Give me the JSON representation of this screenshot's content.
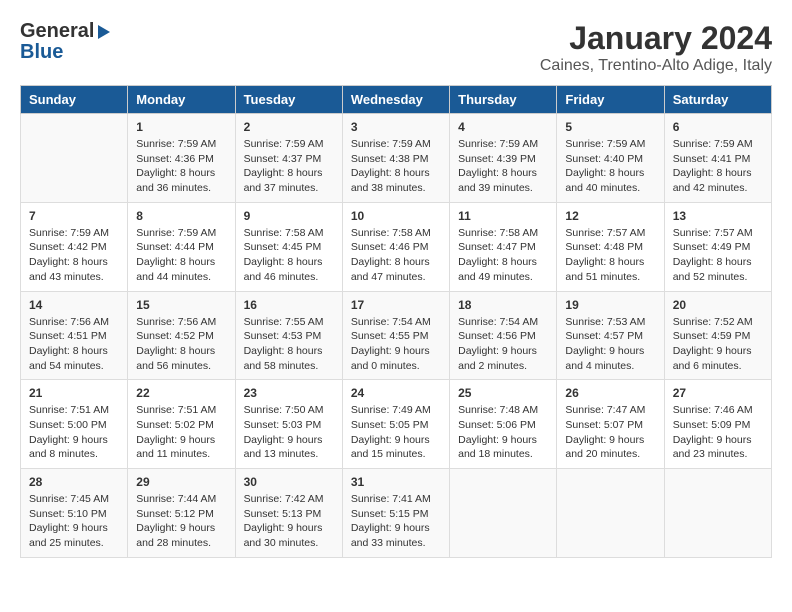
{
  "header": {
    "logo_general": "General",
    "logo_blue": "Blue",
    "month_year": "January 2024",
    "location": "Caines, Trentino-Alto Adige, Italy"
  },
  "days_of_week": [
    "Sunday",
    "Monday",
    "Tuesday",
    "Wednesday",
    "Thursday",
    "Friday",
    "Saturday"
  ],
  "weeks": [
    {
      "days": [
        {
          "num": "",
          "sunrise": "",
          "sunset": "",
          "daylight": ""
        },
        {
          "num": "1",
          "sunrise": "Sunrise: 7:59 AM",
          "sunset": "Sunset: 4:36 PM",
          "daylight": "Daylight: 8 hours and 36 minutes."
        },
        {
          "num": "2",
          "sunrise": "Sunrise: 7:59 AM",
          "sunset": "Sunset: 4:37 PM",
          "daylight": "Daylight: 8 hours and 37 minutes."
        },
        {
          "num": "3",
          "sunrise": "Sunrise: 7:59 AM",
          "sunset": "Sunset: 4:38 PM",
          "daylight": "Daylight: 8 hours and 38 minutes."
        },
        {
          "num": "4",
          "sunrise": "Sunrise: 7:59 AM",
          "sunset": "Sunset: 4:39 PM",
          "daylight": "Daylight: 8 hours and 39 minutes."
        },
        {
          "num": "5",
          "sunrise": "Sunrise: 7:59 AM",
          "sunset": "Sunset: 4:40 PM",
          "daylight": "Daylight: 8 hours and 40 minutes."
        },
        {
          "num": "6",
          "sunrise": "Sunrise: 7:59 AM",
          "sunset": "Sunset: 4:41 PM",
          "daylight": "Daylight: 8 hours and 42 minutes."
        }
      ]
    },
    {
      "days": [
        {
          "num": "7",
          "sunrise": "Sunrise: 7:59 AM",
          "sunset": "Sunset: 4:42 PM",
          "daylight": "Daylight: 8 hours and 43 minutes."
        },
        {
          "num": "8",
          "sunrise": "Sunrise: 7:59 AM",
          "sunset": "Sunset: 4:44 PM",
          "daylight": "Daylight: 8 hours and 44 minutes."
        },
        {
          "num": "9",
          "sunrise": "Sunrise: 7:58 AM",
          "sunset": "Sunset: 4:45 PM",
          "daylight": "Daylight: 8 hours and 46 minutes."
        },
        {
          "num": "10",
          "sunrise": "Sunrise: 7:58 AM",
          "sunset": "Sunset: 4:46 PM",
          "daylight": "Daylight: 8 hours and 47 minutes."
        },
        {
          "num": "11",
          "sunrise": "Sunrise: 7:58 AM",
          "sunset": "Sunset: 4:47 PM",
          "daylight": "Daylight: 8 hours and 49 minutes."
        },
        {
          "num": "12",
          "sunrise": "Sunrise: 7:57 AM",
          "sunset": "Sunset: 4:48 PM",
          "daylight": "Daylight: 8 hours and 51 minutes."
        },
        {
          "num": "13",
          "sunrise": "Sunrise: 7:57 AM",
          "sunset": "Sunset: 4:49 PM",
          "daylight": "Daylight: 8 hours and 52 minutes."
        }
      ]
    },
    {
      "days": [
        {
          "num": "14",
          "sunrise": "Sunrise: 7:56 AM",
          "sunset": "Sunset: 4:51 PM",
          "daylight": "Daylight: 8 hours and 54 minutes."
        },
        {
          "num": "15",
          "sunrise": "Sunrise: 7:56 AM",
          "sunset": "Sunset: 4:52 PM",
          "daylight": "Daylight: 8 hours and 56 minutes."
        },
        {
          "num": "16",
          "sunrise": "Sunrise: 7:55 AM",
          "sunset": "Sunset: 4:53 PM",
          "daylight": "Daylight: 8 hours and 58 minutes."
        },
        {
          "num": "17",
          "sunrise": "Sunrise: 7:54 AM",
          "sunset": "Sunset: 4:55 PM",
          "daylight": "Daylight: 9 hours and 0 minutes."
        },
        {
          "num": "18",
          "sunrise": "Sunrise: 7:54 AM",
          "sunset": "Sunset: 4:56 PM",
          "daylight": "Daylight: 9 hours and 2 minutes."
        },
        {
          "num": "19",
          "sunrise": "Sunrise: 7:53 AM",
          "sunset": "Sunset: 4:57 PM",
          "daylight": "Daylight: 9 hours and 4 minutes."
        },
        {
          "num": "20",
          "sunrise": "Sunrise: 7:52 AM",
          "sunset": "Sunset: 4:59 PM",
          "daylight": "Daylight: 9 hours and 6 minutes."
        }
      ]
    },
    {
      "days": [
        {
          "num": "21",
          "sunrise": "Sunrise: 7:51 AM",
          "sunset": "Sunset: 5:00 PM",
          "daylight": "Daylight: 9 hours and 8 minutes."
        },
        {
          "num": "22",
          "sunrise": "Sunrise: 7:51 AM",
          "sunset": "Sunset: 5:02 PM",
          "daylight": "Daylight: 9 hours and 11 minutes."
        },
        {
          "num": "23",
          "sunrise": "Sunrise: 7:50 AM",
          "sunset": "Sunset: 5:03 PM",
          "daylight": "Daylight: 9 hours and 13 minutes."
        },
        {
          "num": "24",
          "sunrise": "Sunrise: 7:49 AM",
          "sunset": "Sunset: 5:05 PM",
          "daylight": "Daylight: 9 hours and 15 minutes."
        },
        {
          "num": "25",
          "sunrise": "Sunrise: 7:48 AM",
          "sunset": "Sunset: 5:06 PM",
          "daylight": "Daylight: 9 hours and 18 minutes."
        },
        {
          "num": "26",
          "sunrise": "Sunrise: 7:47 AM",
          "sunset": "Sunset: 5:07 PM",
          "daylight": "Daylight: 9 hours and 20 minutes."
        },
        {
          "num": "27",
          "sunrise": "Sunrise: 7:46 AM",
          "sunset": "Sunset: 5:09 PM",
          "daylight": "Daylight: 9 hours and 23 minutes."
        }
      ]
    },
    {
      "days": [
        {
          "num": "28",
          "sunrise": "Sunrise: 7:45 AM",
          "sunset": "Sunset: 5:10 PM",
          "daylight": "Daylight: 9 hours and 25 minutes."
        },
        {
          "num": "29",
          "sunrise": "Sunrise: 7:44 AM",
          "sunset": "Sunset: 5:12 PM",
          "daylight": "Daylight: 9 hours and 28 minutes."
        },
        {
          "num": "30",
          "sunrise": "Sunrise: 7:42 AM",
          "sunset": "Sunset: 5:13 PM",
          "daylight": "Daylight: 9 hours and 30 minutes."
        },
        {
          "num": "31",
          "sunrise": "Sunrise: 7:41 AM",
          "sunset": "Sunset: 5:15 PM",
          "daylight": "Daylight: 9 hours and 33 minutes."
        },
        {
          "num": "",
          "sunrise": "",
          "sunset": "",
          "daylight": ""
        },
        {
          "num": "",
          "sunrise": "",
          "sunset": "",
          "daylight": ""
        },
        {
          "num": "",
          "sunrise": "",
          "sunset": "",
          "daylight": ""
        }
      ]
    }
  ]
}
